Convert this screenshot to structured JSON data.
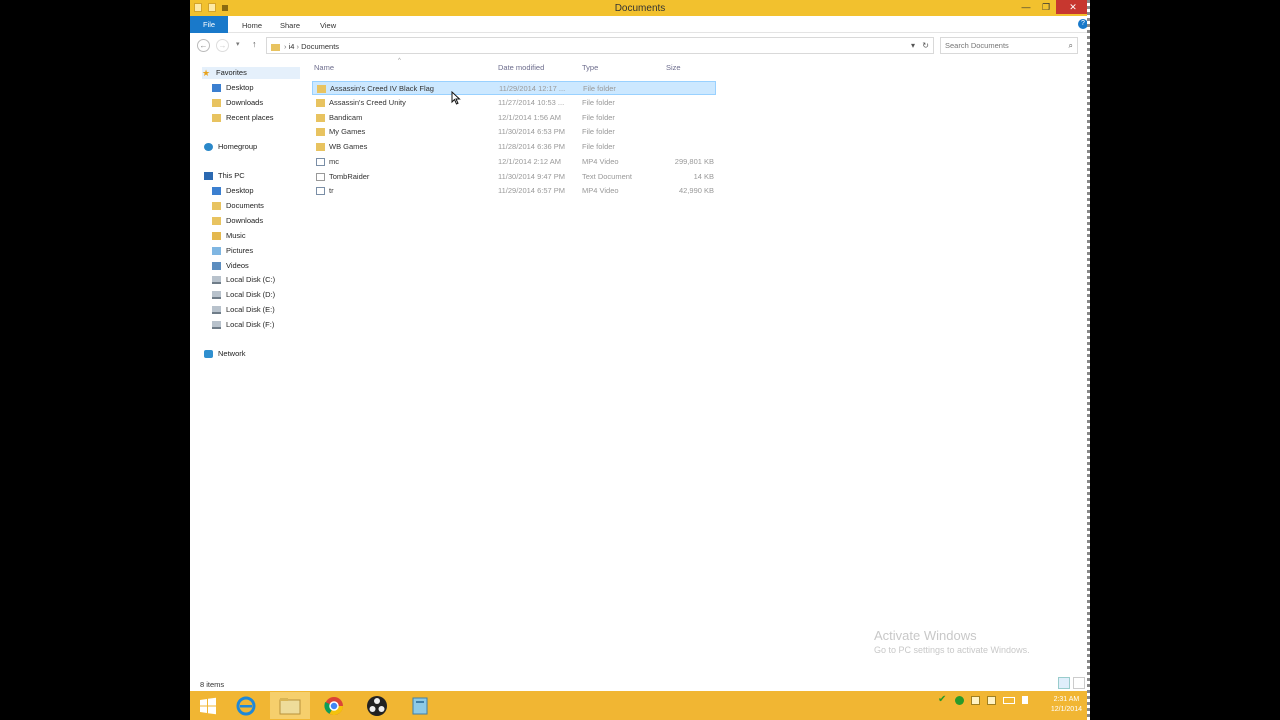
{
  "window": {
    "title": "Documents",
    "minimize": "—",
    "maximize": "❐",
    "close": "✕"
  },
  "ribbon": {
    "tabs": [
      "File",
      "Home",
      "Share",
      "View"
    ],
    "help": "?"
  },
  "address": {
    "segments": [
      "i4",
      "Documents"
    ],
    "search_placeholder": "Search Documents"
  },
  "nav": {
    "favorites": "Favorites",
    "fav_items": [
      "Desktop",
      "Downloads",
      "Recent places"
    ],
    "homegroup": "Homegroup",
    "thispc": "This PC",
    "pc_items": [
      "Desktop",
      "Documents",
      "Downloads",
      "Music",
      "Pictures",
      "Videos",
      "Local Disk (C:)",
      "Local Disk (D:)",
      "Local Disk (E:)",
      "Local Disk (F:)"
    ],
    "network": "Network"
  },
  "columns": [
    "Name",
    "Date modified",
    "Type",
    "Size"
  ],
  "files": [
    {
      "name": "Assassin's Creed IV Black Flag",
      "date": "11/29/2014 12:17 ...",
      "type": "File folder",
      "size": "",
      "kind": "folder"
    },
    {
      "name": "Assassin's Creed Unity",
      "date": "11/27/2014 10:53 ...",
      "type": "File folder",
      "size": "",
      "kind": "folder"
    },
    {
      "name": "Bandicam",
      "date": "12/1/2014 1:56 AM",
      "type": "File folder",
      "size": "",
      "kind": "folder"
    },
    {
      "name": "My Games",
      "date": "11/30/2014 6:53 PM",
      "type": "File folder",
      "size": "",
      "kind": "folder"
    },
    {
      "name": "WB Games",
      "date": "11/28/2014 6:36 PM",
      "type": "File folder",
      "size": "",
      "kind": "folder"
    },
    {
      "name": "mc",
      "date": "12/1/2014 2:12 AM",
      "type": "MP4 Video",
      "size": "299,801 KB",
      "kind": "video"
    },
    {
      "name": "TombRaider",
      "date": "11/30/2014 9:47 PM",
      "type": "Text Document",
      "size": "14 KB",
      "kind": "text"
    },
    {
      "name": "tr",
      "date": "11/29/2014 6:57 PM",
      "type": "MP4 Video",
      "size": "42,990 KB",
      "kind": "video"
    }
  ],
  "status": {
    "items": "8 items"
  },
  "watermark": {
    "line1": "Activate Windows",
    "line2": "Go to PC settings to activate Windows."
  },
  "clock": {
    "time": "2:31 AM",
    "date": "12/1/2014"
  },
  "colors": {
    "titlebar": "#f2c12e",
    "taskbar": "#f1b633",
    "file_tab": "#1979ca",
    "selection": "#cce8ff"
  },
  "taskbar_apps": [
    "start-icon",
    "ie-icon",
    "file-explorer-icon",
    "chrome-icon",
    "obs-icon",
    "app-icon"
  ]
}
